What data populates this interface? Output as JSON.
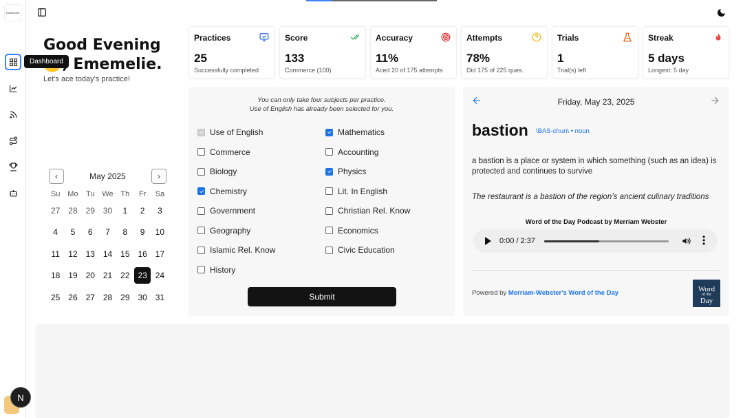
{
  "sidebar": {
    "logo_text": "Dashboard",
    "items": [
      {
        "name": "dashboard",
        "icon": "grid-icon",
        "active": true
      },
      {
        "name": "analytics",
        "icon": "chart-line-icon"
      },
      {
        "name": "feed",
        "icon": "rss-icon"
      },
      {
        "name": "route",
        "icon": "route-icon"
      },
      {
        "name": "trophy",
        "icon": "trophy-icon"
      },
      {
        "name": "bot",
        "icon": "bot-icon"
      }
    ],
    "tooltip": "Dashboard",
    "avatar_letter": "N"
  },
  "greeting": {
    "title": "Good Evening🌙, Ememelie.",
    "subtitle": "Let's ace today's practice!"
  },
  "stats": [
    {
      "title": "Practices",
      "value": "25",
      "sub": "Successfully completed",
      "icon": "monitor-check-icon",
      "color": "#2563eb"
    },
    {
      "title": "Score",
      "value": "133",
      "sub": "Commerce (100)",
      "icon": "double-check-icon",
      "color": "#16a34a"
    },
    {
      "title": "Accuracy",
      "value": "11%",
      "sub": "Aced 20 of 175 attempts",
      "icon": "target-icon",
      "color": "#dc2626"
    },
    {
      "title": "Attempts",
      "value": "78%",
      "sub": "Did 175 of 225 ques.",
      "icon": "help-circle-icon",
      "color": "#eab308"
    },
    {
      "title": "Trials",
      "value": "1",
      "sub": "Trial(s) left",
      "icon": "flask-icon",
      "color": "#ea580c"
    },
    {
      "title": "Streak",
      "value": "5 days",
      "sub": "Longest: 5 day",
      "icon": "flame-icon",
      "color": "#ef4444"
    }
  ],
  "calendar": {
    "month": "May 2025",
    "dow": [
      "Su",
      "Mo",
      "Tu",
      "We",
      "Th",
      "Fr",
      "Sa"
    ],
    "days": [
      {
        "d": "27",
        "muted": true
      },
      {
        "d": "28",
        "muted": true
      },
      {
        "d": "29",
        "muted": true
      },
      {
        "d": "30",
        "muted": true
      },
      {
        "d": "1"
      },
      {
        "d": "2"
      },
      {
        "d": "3"
      },
      {
        "d": "4"
      },
      {
        "d": "5"
      },
      {
        "d": "6"
      },
      {
        "d": "7"
      },
      {
        "d": "8"
      },
      {
        "d": "9"
      },
      {
        "d": "10"
      },
      {
        "d": "11"
      },
      {
        "d": "12"
      },
      {
        "d": "13"
      },
      {
        "d": "14"
      },
      {
        "d": "15"
      },
      {
        "d": "16"
      },
      {
        "d": "17"
      },
      {
        "d": "18"
      },
      {
        "d": "19"
      },
      {
        "d": "20"
      },
      {
        "d": "21"
      },
      {
        "d": "22"
      },
      {
        "d": "23",
        "selected": true
      },
      {
        "d": "24"
      },
      {
        "d": "25"
      },
      {
        "d": "26"
      },
      {
        "d": "27"
      },
      {
        "d": "28"
      },
      {
        "d": "29"
      },
      {
        "d": "30"
      },
      {
        "d": "31"
      }
    ]
  },
  "subjects": {
    "notice_line1": "You can only take four subjects per practice.",
    "notice_line2": "Use of English has already been selected for you.",
    "left": [
      {
        "label": "Use of English",
        "state": "disabled"
      },
      {
        "label": "Commerce",
        "state": "off"
      },
      {
        "label": "Biology",
        "state": "off"
      },
      {
        "label": "Chemistry",
        "state": "on"
      },
      {
        "label": "Government",
        "state": "off"
      },
      {
        "label": "Geography",
        "state": "off"
      },
      {
        "label": "Islamic Rel. Know",
        "state": "off"
      },
      {
        "label": "History",
        "state": "off"
      }
    ],
    "right": [
      {
        "label": "Mathematics",
        "state": "on"
      },
      {
        "label": "Accounting",
        "state": "off"
      },
      {
        "label": "Physics",
        "state": "on"
      },
      {
        "label": "Lit. In English",
        "state": "off"
      },
      {
        "label": "Christian Rel. Know",
        "state": "off"
      },
      {
        "label": "Economics",
        "state": "off"
      },
      {
        "label": "Civic Education",
        "state": "off"
      }
    ],
    "submit_label": "Submit"
  },
  "wotd": {
    "date": "Friday, May 23, 2025",
    "word": "bastion",
    "pronunciation": "\\BAS-chun\\ • noun",
    "definition": "a bastion is a place or system in which something (such as an idea) is protected and continues to survive",
    "example": "The restaurant is a bastion of the region’s ancient culinary traditions",
    "podcast_title": "Word of the Day Podcast by Merriam Webster",
    "time": "0:00 / 2:37",
    "progress": 0.44,
    "powered_prefix": "Powered by ",
    "powered_link": "Merriam-Webster's Word of the Day",
    "logo_line1": "Word",
    "logo_line2": "of the",
    "logo_line3": "Day"
  },
  "top_progress": 0.2
}
